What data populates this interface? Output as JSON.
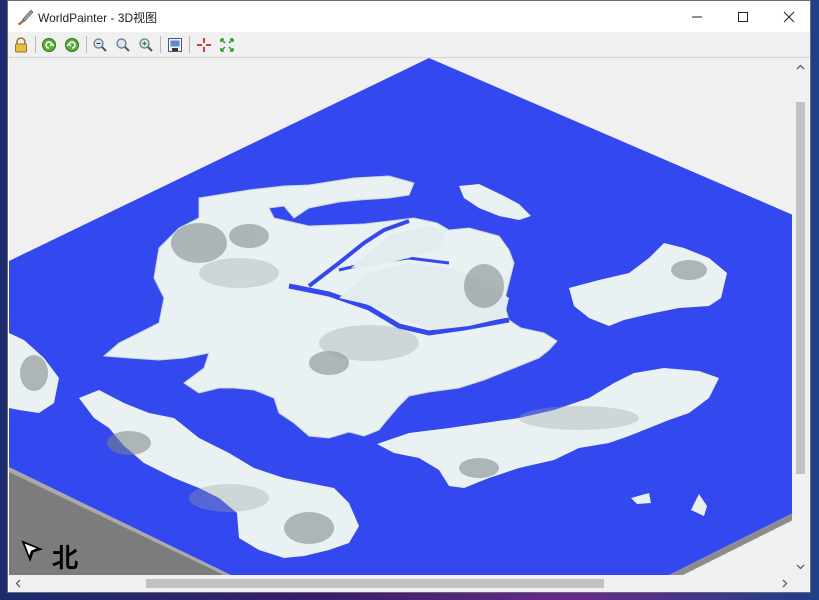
{
  "window": {
    "title": "WorldPainter - 3D视图",
    "controls": {
      "minimize_icon": "minimize-icon",
      "maximize_icon": "maximize-icon",
      "close_icon": "close-icon"
    }
  },
  "toolbar": {
    "buttons": [
      {
        "name": "lock-button",
        "icon": "lock-icon"
      },
      {
        "name": "rotate-left-button",
        "icon": "rotate-left-icon"
      },
      {
        "name": "rotate-right-button",
        "icon": "rotate-right-icon"
      },
      {
        "name": "zoom-out-button",
        "icon": "zoom-out-icon"
      },
      {
        "name": "zoom-reset-button",
        "icon": "zoom-reset-icon"
      },
      {
        "name": "zoom-in-button",
        "icon": "zoom-in-icon"
      },
      {
        "name": "export-image-button",
        "icon": "export-image-icon"
      },
      {
        "name": "move-to-spawn-button",
        "icon": "crosshair-icon"
      },
      {
        "name": "move-to-origin-button",
        "icon": "origin-icon"
      }
    ]
  },
  "view": {
    "compass_label": "北",
    "colors": {
      "water": "#3448f0",
      "land": "#eaf1f2",
      "background": "#f0f0f0",
      "platform_edge": "#8a8a8a"
    },
    "scroll": {
      "horizontal_fraction": 0.6,
      "vertical_fraction": 0.82
    }
  }
}
